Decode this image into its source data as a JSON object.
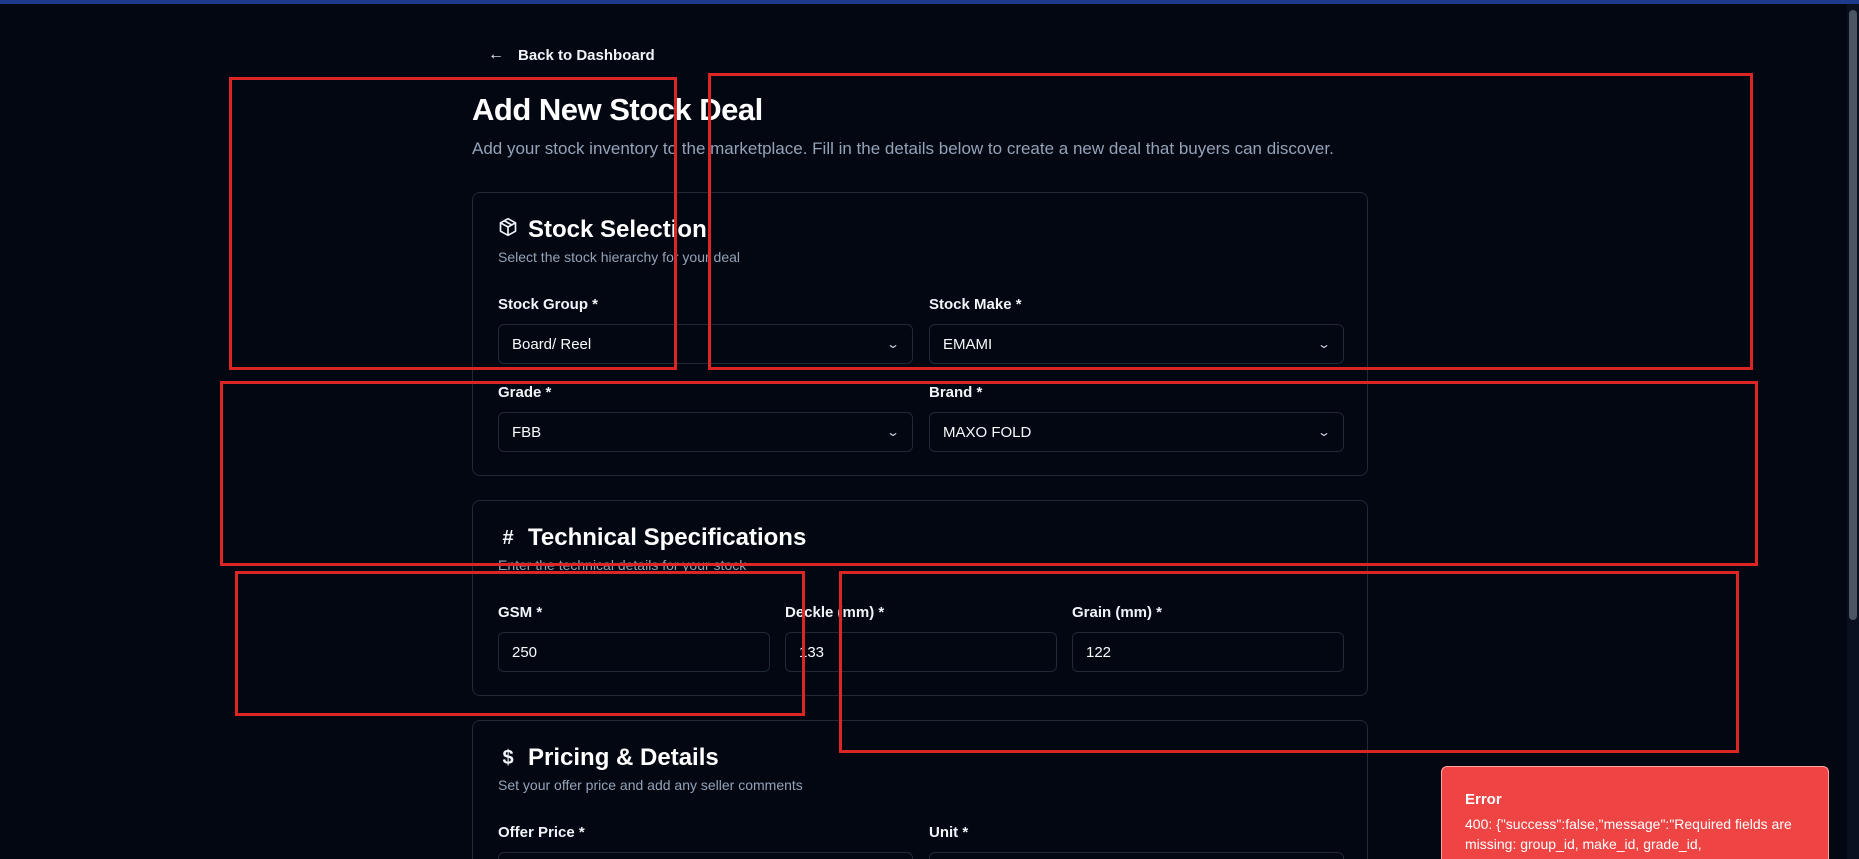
{
  "nav": {
    "back_label": "Back to Dashboard"
  },
  "header": {
    "title": "Add New Stock Deal",
    "subtitle": "Add your stock inventory to the marketplace. Fill in the details below to create a new deal that buyers can discover."
  },
  "stock_selection": {
    "title": "Stock Selection",
    "description": "Select the stock hierarchy for your deal",
    "icon": "package-icon",
    "fields": {
      "stock_group": {
        "label": "Stock Group *",
        "value": "Board/ Reel"
      },
      "stock_make": {
        "label": "Stock Make *",
        "value": "EMAMI"
      },
      "grade": {
        "label": "Grade *",
        "value": "FBB"
      },
      "brand": {
        "label": "Brand *",
        "value": "MAXO FOLD"
      }
    }
  },
  "technical_specs": {
    "title": "Technical Specifications",
    "description": "Enter the technical details for your stock",
    "icon": "hash-icon",
    "fields": {
      "gsm": {
        "label": "GSM *",
        "value": "250"
      },
      "deckle": {
        "label": "Deckle (mm) *",
        "value": "133"
      },
      "grain": {
        "label": "Grain (mm) *",
        "value": "122"
      }
    }
  },
  "pricing": {
    "title": "Pricing & Details",
    "description": "Set your offer price and add any seller comments",
    "icon": "dollar-icon",
    "fields": {
      "offer_price": {
        "label": "Offer Price *"
      },
      "unit": {
        "label": "Unit *"
      }
    }
  },
  "toast": {
    "title": "Error",
    "message": "400: {\"success\":false,\"message\":\"Required fields are missing: group_id, make_id, grade_id,"
  },
  "colors": {
    "background": "#030712",
    "card_border": "#1f2937",
    "muted_text": "#94a3b8",
    "highlight_box": "#dc2626",
    "error_toast": "#ef4444"
  }
}
